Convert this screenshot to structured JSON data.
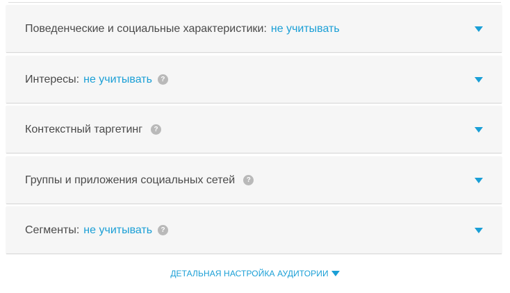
{
  "accent_color": "#1a9fd6",
  "panels": [
    {
      "label": "Поведенческие и социальные характеристики:",
      "value": "не учитывать",
      "has_help": false
    },
    {
      "label": "Интересы:",
      "value": "не учитывать",
      "has_help": true,
      "help_icon": "?"
    },
    {
      "label": "Контекстный таргетинг",
      "value": "",
      "has_help": true,
      "help_icon": "?"
    },
    {
      "label": "Группы и приложения социальных сетей",
      "value": "",
      "has_help": true,
      "help_icon": "?"
    },
    {
      "label": "Сегменты:",
      "value": "не учитывать",
      "has_help": true,
      "help_icon": "?"
    }
  ],
  "footer": {
    "link_label": "ДЕТАЛЬНАЯ НАСТРОЙКА АУДИТОРИИ"
  },
  "icons": {
    "expand": "chevron-down-icon",
    "help": "help-icon"
  }
}
